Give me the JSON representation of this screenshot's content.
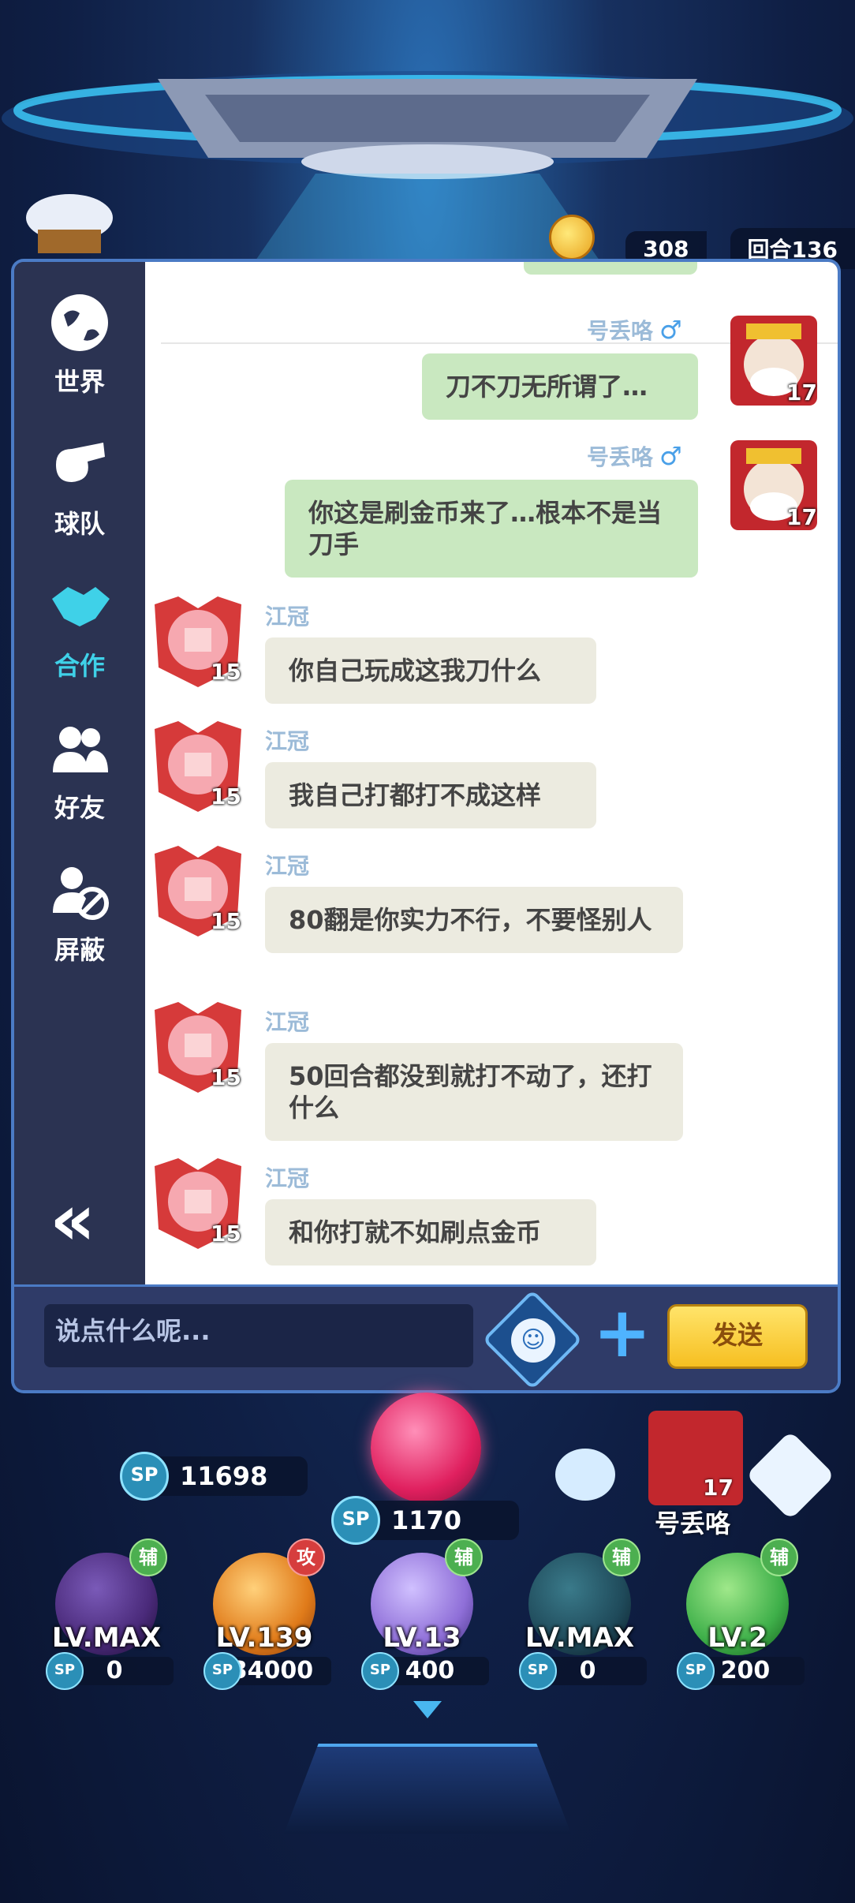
{
  "top": {
    "coins": "308",
    "round": "回合136"
  },
  "sidebar": {
    "items": [
      {
        "label": "世界",
        "icon": "globe-icon"
      },
      {
        "label": "球队",
        "icon": "whistle-icon"
      },
      {
        "label": "合作",
        "icon": "handshake-icon",
        "active": true
      },
      {
        "label": "好友",
        "icon": "friends-icon"
      },
      {
        "label": "屏蔽",
        "icon": "block-user-icon"
      }
    ],
    "collapse_label": "«"
  },
  "chat": {
    "messages": [
      {
        "sender": "号丢咯",
        "gender": "♂",
        "level": "17",
        "self": true,
        "text": "刀不刀无所谓了…"
      },
      {
        "sender": "号丢咯",
        "gender": "♂",
        "level": "17",
        "self": true,
        "text": "你这是刷金币来了…根本不是当刀手"
      },
      {
        "sender": "江冠",
        "level": "15",
        "self": false,
        "text": "你自己玩成这我刀什么"
      },
      {
        "sender": "江冠",
        "level": "15",
        "self": false,
        "text": "我自己打都打不成这样"
      },
      {
        "sender": "江冠",
        "level": "15",
        "self": false,
        "text": "80翻是你实力不行，不要怪别人"
      },
      {
        "sender": "江冠",
        "level": "15",
        "self": false,
        "text": "50回合都没到就打不动了，还打什么"
      },
      {
        "sender": "江冠",
        "level": "15",
        "self": false,
        "text": "和你打就不如刷点金币"
      }
    ]
  },
  "input": {
    "placeholder": "说点什么呢...",
    "send_label": "发送"
  },
  "hud": {
    "sp_total": "11698",
    "sp_center": "1170",
    "sp_label": "SP",
    "player_name": "号丢咯",
    "player_level": "17"
  },
  "heroes": [
    {
      "tag": "辅",
      "tag_color": "#4caf50",
      "level": "LV.MAX",
      "sp": "0",
      "color": "#4a2a7a"
    },
    {
      "tag": "攻",
      "tag_color": "#d63d3d",
      "level": "LV.139",
      "sp": "34000",
      "color": "#e07b1a"
    },
    {
      "tag": "辅",
      "tag_color": "#4caf50",
      "level": "LV.13",
      "sp": "400",
      "color": "#8f6fd8"
    },
    {
      "tag": "辅",
      "tag_color": "#4caf50",
      "level": "LV.MAX",
      "sp": "0",
      "color": "#1f4a5a"
    },
    {
      "tag": "辅",
      "tag_color": "#4caf50",
      "level": "LV.2",
      "sp": "200",
      "color": "#3fb04a"
    }
  ]
}
